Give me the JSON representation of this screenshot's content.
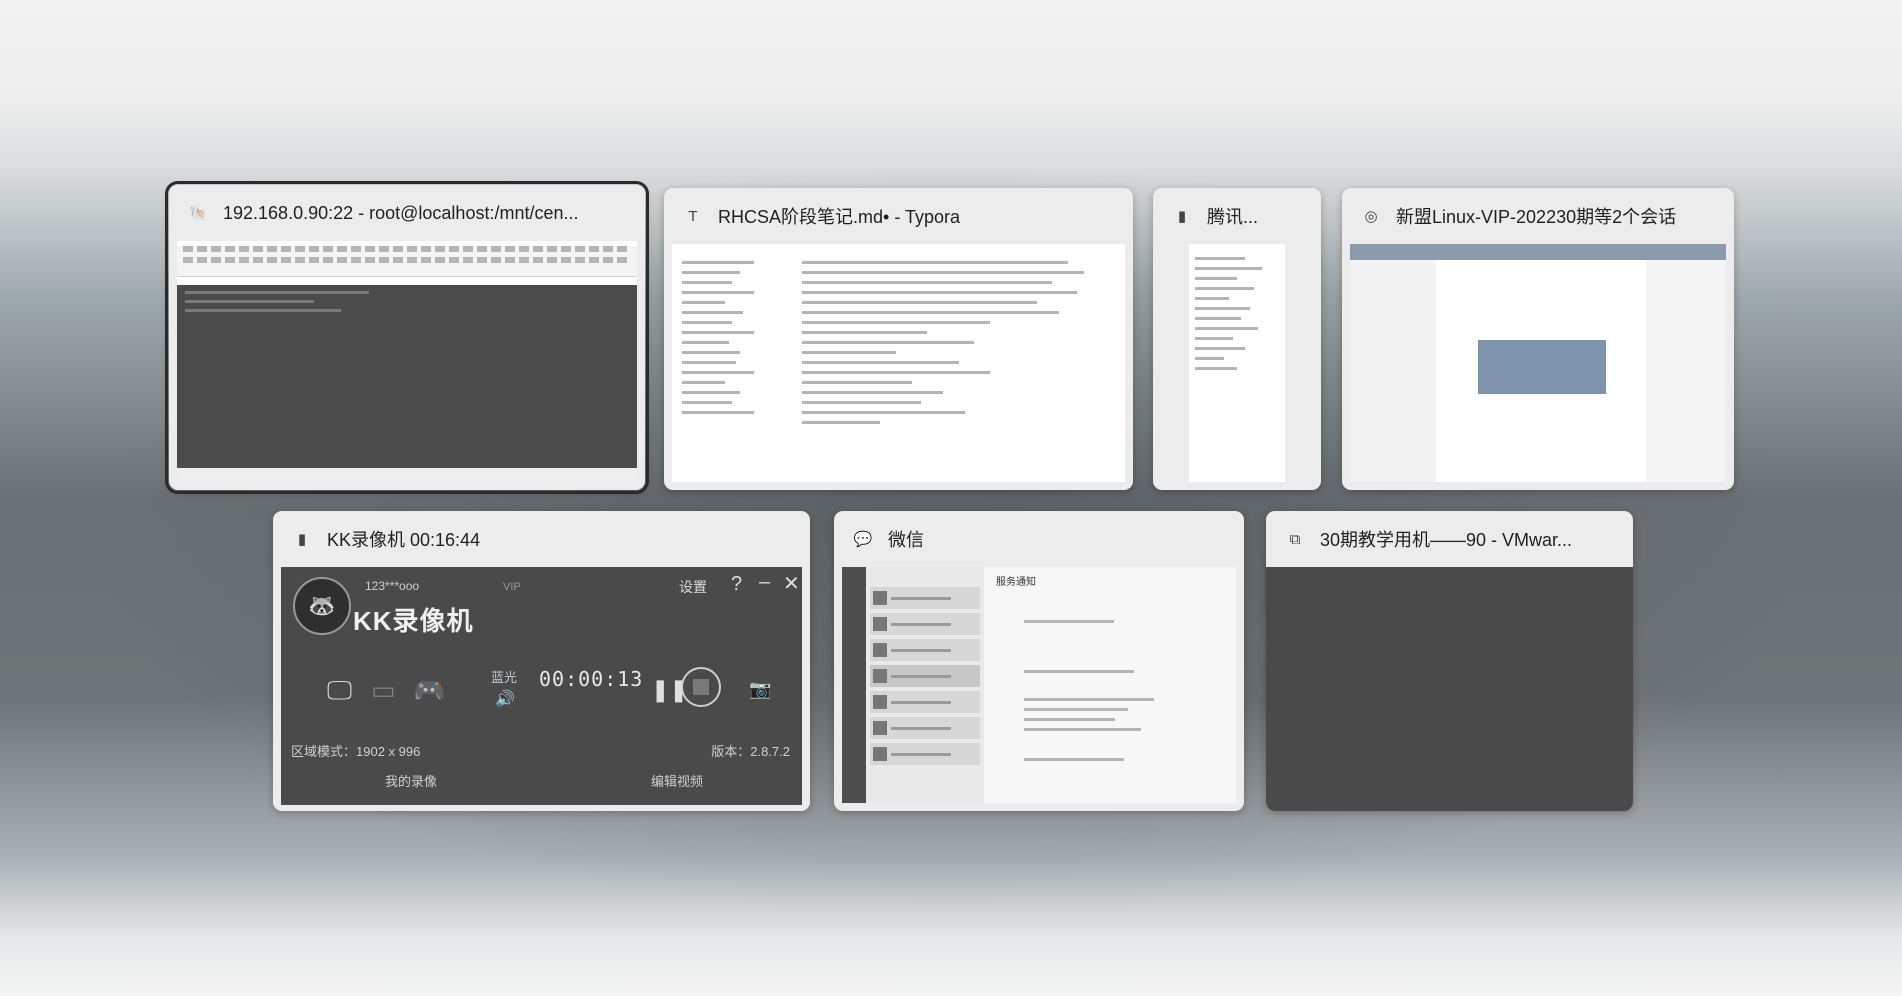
{
  "windows": [
    {
      "id": "xshell",
      "title": "192.168.0.90:22 - root@localhost:/mnt/cen...",
      "icon": "terminal-icon",
      "selected": true
    },
    {
      "id": "typora",
      "title": "RHCSA阶段笔记.md• - Typora",
      "icon": "typora-icon"
    },
    {
      "id": "tencent",
      "title": "腾讯...",
      "icon": "tencent-icon"
    },
    {
      "id": "qq",
      "title": "新盟Linux-VIP-202230期等2个会话",
      "icon": "qq-icon"
    },
    {
      "id": "kk",
      "title": "KK录像机 00:16:44",
      "icon": "kk-recorder-icon"
    },
    {
      "id": "wechat",
      "title": "微信",
      "icon": "wechat-icon"
    },
    {
      "id": "vmware",
      "title": "30期教学用机——90 - VMwar...",
      "icon": "vmware-icon"
    }
  ],
  "kk": {
    "user": "123***ooo",
    "vip": "VIP",
    "name": "KK录像机",
    "settings": "设置",
    "blue": "蓝光",
    "timer": "00:00:13",
    "region": "区域模式：1902 x 996",
    "version": "版本：2.8.7.2",
    "my_videos": "我的录像",
    "edit_video": "编辑视频"
  },
  "wechat": {
    "chat_title": "服务通知"
  }
}
